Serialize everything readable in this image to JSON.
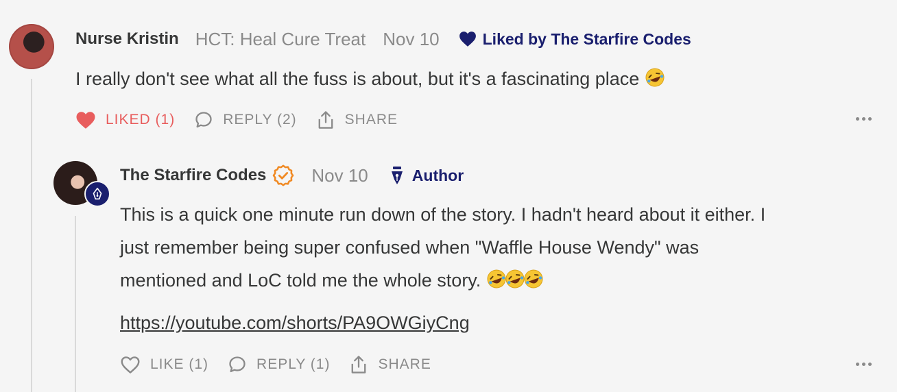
{
  "comments": [
    {
      "author": "Nurse Kristin",
      "publication": "HCT: Heal Cure Treat",
      "date": "Nov 10",
      "liked_by": "Liked by The Starfire Codes",
      "body": "I really don't see what all the fuss is about, but it's a fascinating place",
      "emoji_count": 1,
      "actions": {
        "like": "LIKED (1)",
        "reply": "REPLY (2)",
        "share": "SHARE"
      },
      "liked": true
    },
    {
      "author": "The Starfire Codes",
      "date": "Nov 10",
      "badge": "Author",
      "body_lines": [
        "This is a quick one minute run down of the story. I hadn't heard about it either. I",
        "just remember being super confused when \"Waffle House Wendy\" was",
        "mentioned and LoC told me the whole story."
      ],
      "emoji_count": 3,
      "link": "https://youtube.com/shorts/PA9OWGiyCng",
      "actions": {
        "like": "LIKE (1)",
        "reply": "REPLY (1)",
        "share": "SHARE"
      },
      "liked": false
    }
  ],
  "colors": {
    "accent_navy": "#1a1f6e",
    "liked_red": "#e85d5d",
    "verified_orange": "#f08a24",
    "muted": "#8a8a8a"
  },
  "icons": [
    "heart-icon",
    "comment-bubble-icon",
    "share-icon",
    "more-dots-icon",
    "verified-check-icon",
    "fountain-pen-icon",
    "laughing-emoji"
  ]
}
